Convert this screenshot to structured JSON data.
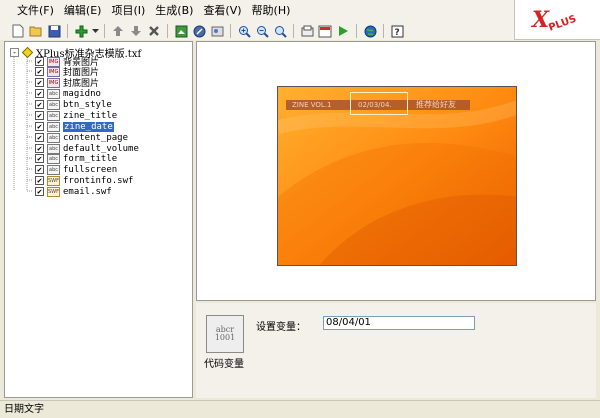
{
  "menu": [
    "文件(F)",
    "编辑(E)",
    "项目(I)",
    "生成(B)",
    "查看(V)",
    "帮助(H)"
  ],
  "logo": "XPlus",
  "toolbar": {
    "icons": [
      "new-file-icon",
      "open-folder-icon",
      "save-icon",
      "add-icon",
      "dropdown-arrow-icon",
      "move-up-icon",
      "move-down-icon",
      "delete-icon",
      "import-image-icon",
      "settings-icon",
      "replace-icon",
      "zoom-in-icon",
      "zoom-out-icon",
      "zoom-fit-icon",
      "publish-icon",
      "html-icon",
      "play-icon",
      "web-icon",
      "help-icon"
    ]
  },
  "tree": {
    "root": "XPlus标准杂志模版.txf",
    "items": [
      {
        "label": "背景图片",
        "type": "image"
      },
      {
        "label": "封面图片",
        "type": "image"
      },
      {
        "label": "封底图片",
        "type": "image"
      },
      {
        "label": "magidno",
        "type": "text"
      },
      {
        "label": "btn_style",
        "type": "text"
      },
      {
        "label": "zine_title",
        "type": "text"
      },
      {
        "label": "zine_date",
        "type": "text",
        "selected": true
      },
      {
        "label": "content_page",
        "type": "text"
      },
      {
        "label": "default_volume",
        "type": "text"
      },
      {
        "label": "form_title",
        "type": "text"
      },
      {
        "label": "fullscreen",
        "type": "text"
      },
      {
        "label": "frontinfo.swf",
        "type": "swf"
      },
      {
        "label": "email.swf",
        "type": "swf"
      }
    ]
  },
  "preview": {
    "volume_label": "ZINE VOL.1",
    "date_label": "02/03/04.",
    "recommend_label": "推荐给好友"
  },
  "bottom": {
    "code_btn_icon_text1": "abcr",
    "code_btn_icon_text2": "1001",
    "code_btn_label": "代码变量",
    "var_label": "设置变量：",
    "var_value": "08/04/01"
  },
  "status": "日期文字",
  "colors": {
    "orange_light": "#ffa62a",
    "orange_dark": "#e85e00",
    "selection": "#316ac5"
  }
}
